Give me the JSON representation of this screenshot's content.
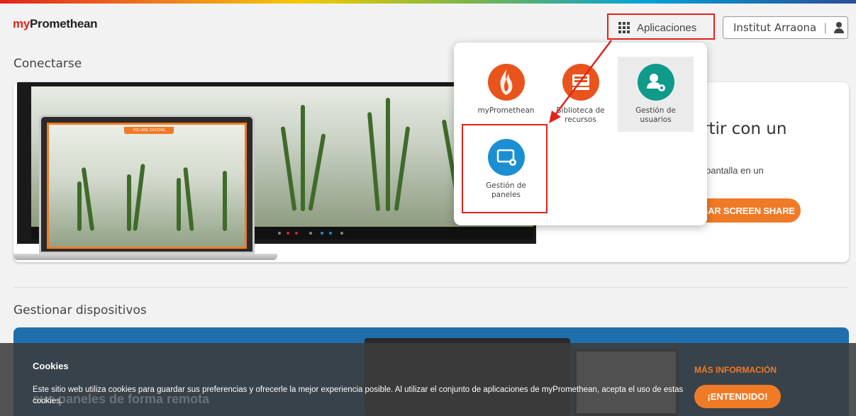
{
  "header": {
    "logo_prefix": "my",
    "logo_name": "Promethean",
    "apps_label": "Aplicaciones",
    "school_label": "Institut Arraona",
    "separator": "|"
  },
  "connect": {
    "title": "Conectarse",
    "casting_badge": "YOU ARE CASTING",
    "heading_fragment": "rtir con un",
    "desc_fragment": "pantalla en un",
    "cta_label": "GAR SCREEN SHARE"
  },
  "devices": {
    "title": "Gestionar dispositivos",
    "ghost_text": "sus paneles de forma remota"
  },
  "apps_menu": {
    "items": [
      {
        "label": "myPromethean",
        "icon": "flame-icon",
        "color": "#e8541b"
      },
      {
        "label": "Biblioteca de recursos",
        "icon": "library-icon",
        "color": "#e8541b"
      },
      {
        "label": "Gestión de usuarios",
        "icon": "user-gear-icon",
        "color": "#0f9a8a"
      },
      {
        "label": "Gestión de paneles",
        "icon": "panel-gear-icon",
        "color": "#1a8fd1"
      }
    ]
  },
  "cookies": {
    "title": "Cookies",
    "text": "Este sitio web utiliza cookies para guardar sus preferencias y ofrecerle la mejor experiencia posible. Al utilizar el conjunto de aplicaciones de myPromethean, acepta el uso de estas cookies.",
    "more_label": "MÁS INFORMACIÓN",
    "accept_label": "¡ENTENDIDO!"
  },
  "colors": {
    "accent": "#f07a26",
    "annotation_red": "#e2231a"
  }
}
